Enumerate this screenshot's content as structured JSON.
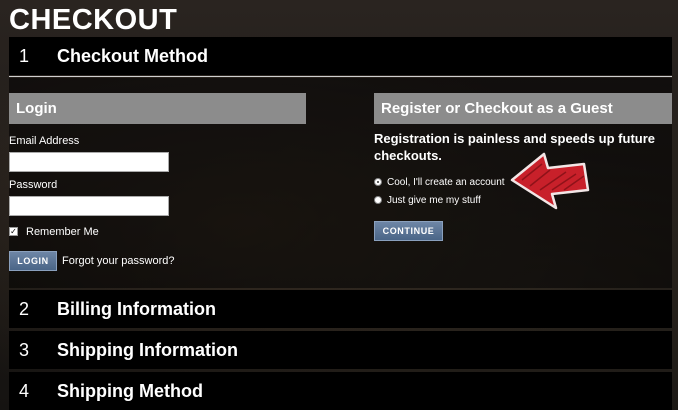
{
  "page": {
    "title": "CHECKOUT"
  },
  "steps": [
    {
      "number": "1",
      "label": "Checkout Method"
    },
    {
      "number": "2",
      "label": "Billing Information"
    },
    {
      "number": "3",
      "label": "Shipping Information"
    },
    {
      "number": "4",
      "label": "Shipping Method"
    }
  ],
  "login": {
    "heading": "Login",
    "email_label": "Email Address",
    "email_value": "",
    "password_label": "Password",
    "password_value": "",
    "remember_label": "Remember Me",
    "remember_checked": true,
    "login_button": "LOGIN",
    "forgot_link": "Forgot your password?"
  },
  "register": {
    "heading": "Register or Checkout as a Guest",
    "text": "Registration is painless and speeds up future checkouts.",
    "options": [
      {
        "label": "Cool, I'll create an account",
        "selected": true
      },
      {
        "label": "Just give me my stuff",
        "selected": false
      }
    ],
    "continue_button": "CONTINUE"
  },
  "annotation": {
    "arrow_color": "#c8202a",
    "arrow_icon": "red-arrow-icon"
  }
}
